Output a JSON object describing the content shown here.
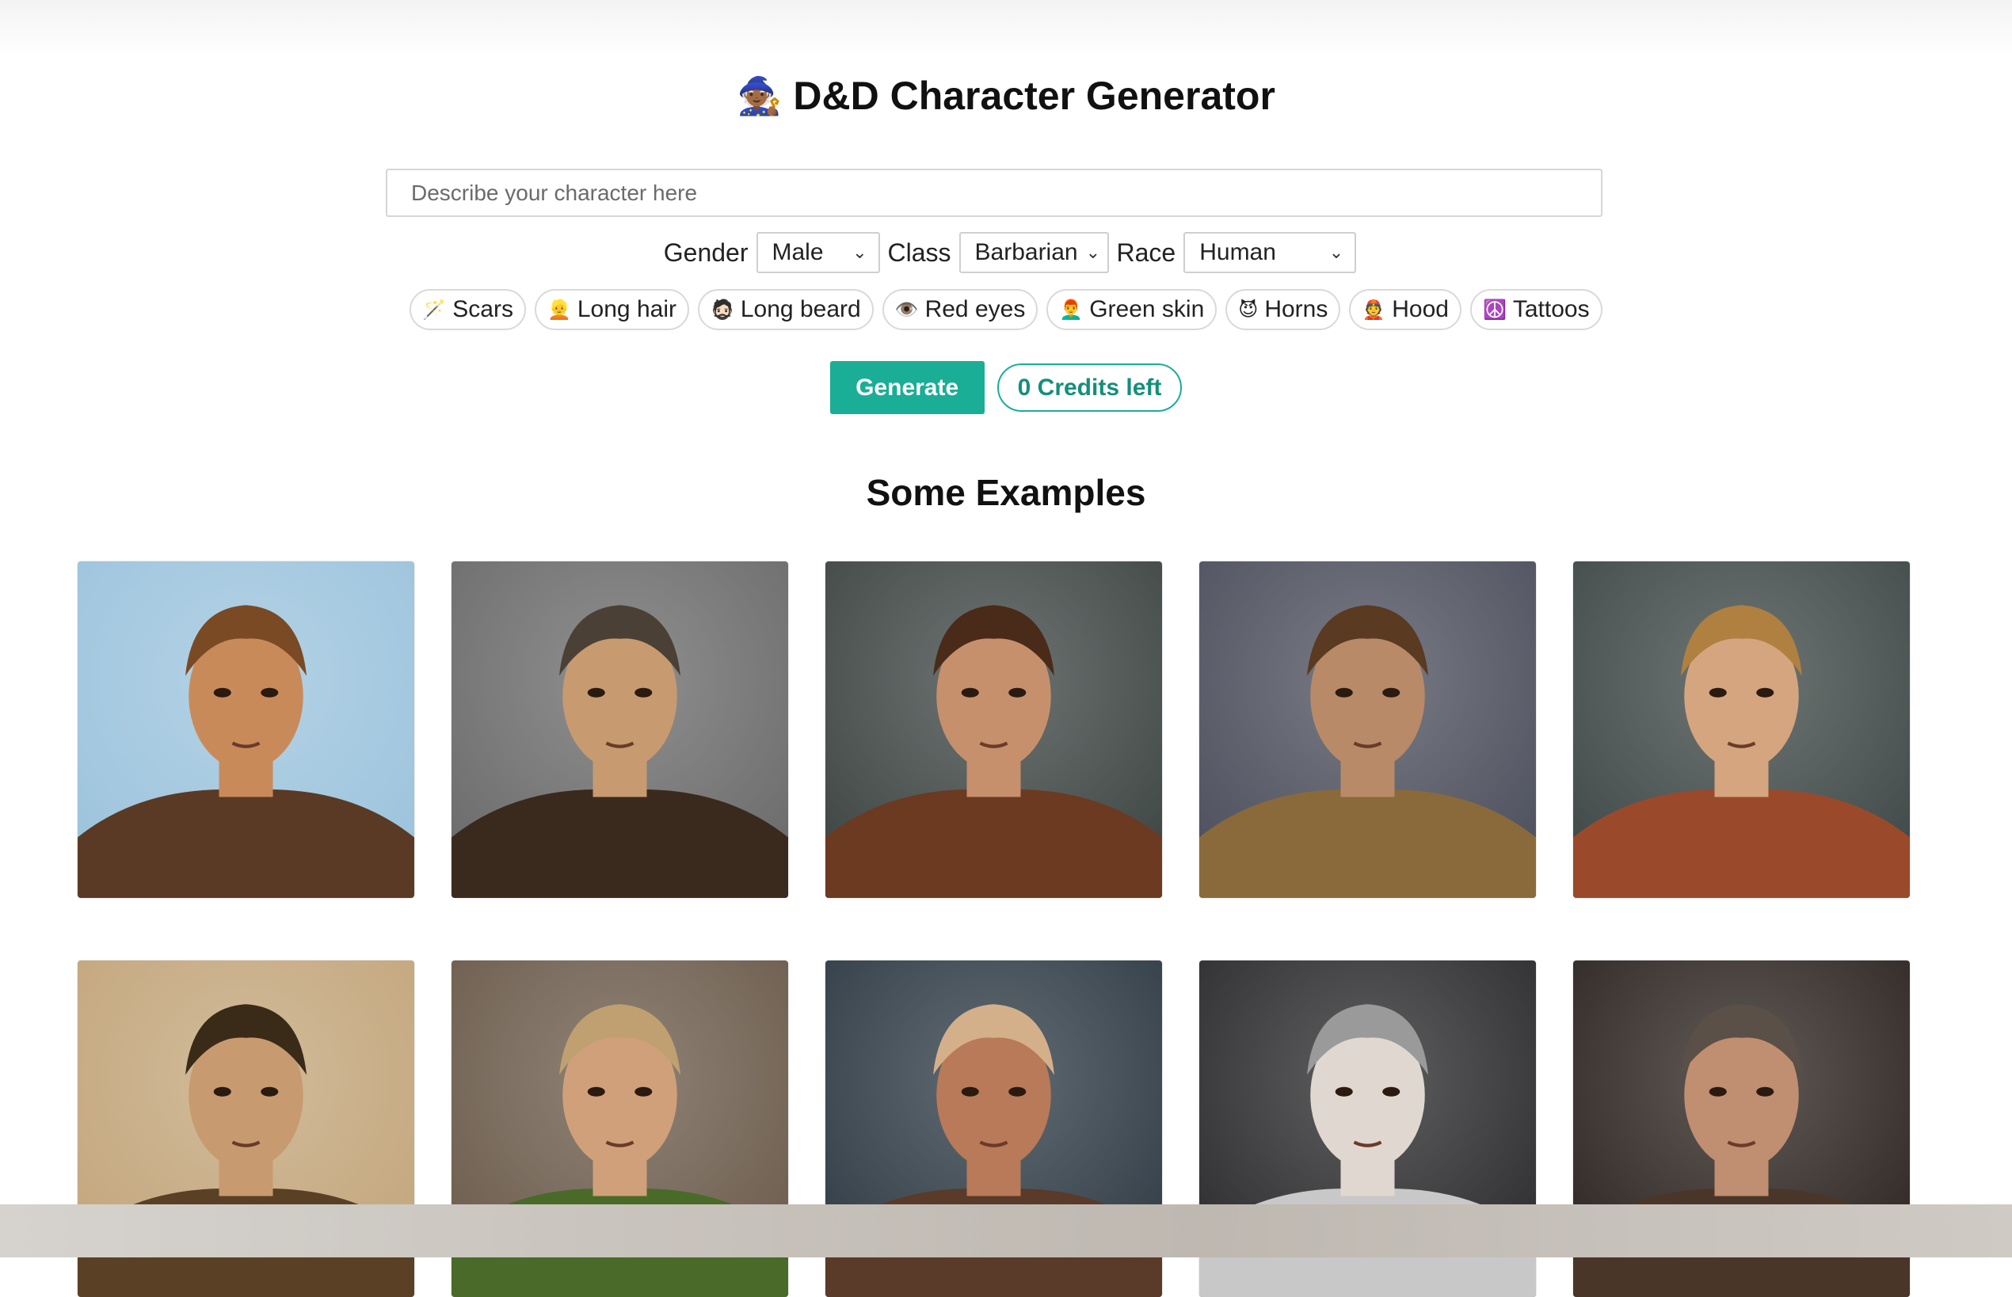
{
  "header": {
    "emoji": "🧙🏾",
    "title": "D&D Character Generator"
  },
  "search": {
    "placeholder": "Describe your character here"
  },
  "selectors": {
    "gender": {
      "label": "Gender",
      "value": "Male"
    },
    "class": {
      "label": "Class",
      "value": "Barbarian"
    },
    "race": {
      "label": "Race",
      "value": "Human"
    }
  },
  "traits": [
    {
      "icon": "🪄",
      "icon_name": "wand-icon",
      "label": "Scars"
    },
    {
      "icon": "👱",
      "icon_name": "blond-person-icon",
      "label": "Long hair"
    },
    {
      "icon": "🧔🏻",
      "icon_name": "bearded-person-icon",
      "label": "Long beard"
    },
    {
      "icon": "👁️",
      "icon_name": "eye-icon",
      "label": "Red eyes"
    },
    {
      "icon": "👨‍🦰",
      "icon_name": "person-icon",
      "label": "Green skin"
    },
    {
      "icon": "😈",
      "icon_name": "devil-icon",
      "label": "Horns"
    },
    {
      "icon": "👲",
      "icon_name": "hooded-person-icon",
      "label": "Hood"
    },
    {
      "icon": "☮️",
      "icon_name": "peace-icon",
      "label": "Tattoos"
    }
  ],
  "actions": {
    "generate_label": "Generate",
    "credits_label": "0 Credits left"
  },
  "examples": {
    "title": "Some Examples",
    "images": [
      {
        "name": "example-portrait-red-haired-warrior",
        "colors": [
          "#9bc3dc",
          "#5a3a24",
          "#c98a5a",
          "#7a4a25"
        ]
      },
      {
        "name": "example-portrait-dark-haired-man",
        "colors": [
          "#6a6a6a",
          "#3a2a1e",
          "#c79a70",
          "#4a4035"
        ]
      },
      {
        "name": "example-portrait-helmeted-woman",
        "colors": [
          "#3d4543",
          "#6b3a20",
          "#c6906d",
          "#4a2a18"
        ]
      },
      {
        "name": "example-portrait-crowned-king",
        "colors": [
          "#4c4f5c",
          "#8a6a3a",
          "#b88a68",
          "#5a3a20"
        ]
      },
      {
        "name": "example-portrait-bald-monk",
        "colors": [
          "#3e4846",
          "#9a4a2a",
          "#d4a57e",
          "#b08040"
        ]
      },
      {
        "name": "example-portrait-horned-elf-woman",
        "colors": [
          "#c2a57a",
          "#5a4024",
          "#c89a70",
          "#3a2a18"
        ]
      },
      {
        "name": "example-portrait-blonde-ranger",
        "colors": [
          "#6a5a4a",
          "#4a6a2a",
          "#d0a07a",
          "#c0a070"
        ]
      },
      {
        "name": "example-portrait-horned-barbarian",
        "colors": [
          "#2e3a44",
          "#5a3a28",
          "#b87a58",
          "#d4b08a"
        ]
      },
      {
        "name": "example-portrait-silver-haired-elf",
        "colors": [
          "#2a2a2c",
          "#c8c8c8",
          "#e0d8d0",
          "#9a9a9a"
        ]
      },
      {
        "name": "example-portrait-bearded-dwarf",
        "colors": [
          "#2c2420",
          "#4a3628",
          "#c08e70",
          "#5a5048"
        ]
      }
    ]
  }
}
